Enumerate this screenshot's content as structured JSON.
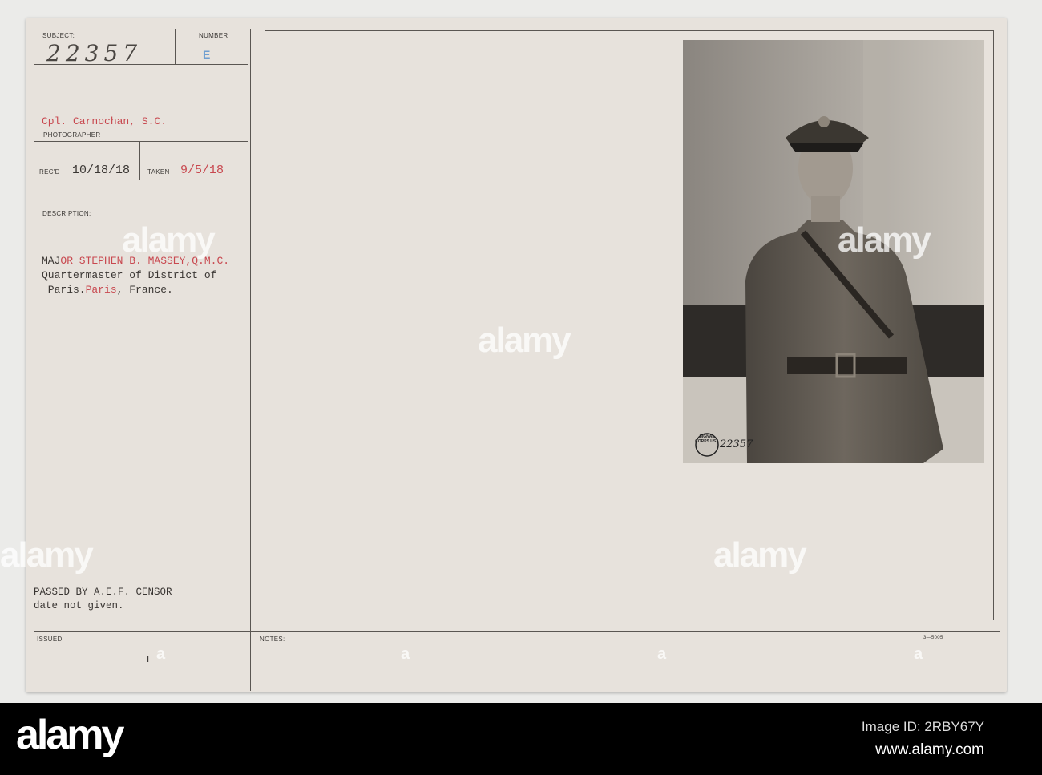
{
  "card": {
    "subject_label": "SUBJECT:",
    "subject_value": "22357",
    "number_label": "NUMBER",
    "number_value": "E",
    "photographer_value": "Cpl. Carnochan, S.C.",
    "photographer_label": "PHOTOGRAPHER",
    "recd_label": "REC'D",
    "recd_value": "10/18/18",
    "taken_label": "TAKEN",
    "taken_value": "9/5/18",
    "description_label": "DESCRIPTION:",
    "description_line1_a": "MAJ",
    "description_line1_b": "OR STEPHEN B. MASSEY,Q.M.C.",
    "description_line2": "Quartermaster of District of",
    "description_line3_a": " Paris.",
    "description_line3_b": "Paris",
    "description_line3_c": ", France.",
    "censor_line1": "PASSED BY A.E.F. CENSOR",
    "censor_line2": "date not given.",
    "issued_label": "ISSUED",
    "issued_value": "T",
    "notes_label": "NOTES:",
    "form_number": "3—5005",
    "photo_stamp_number": "22357",
    "photo_stamp_text": "SIGNAL CORPS USA"
  },
  "watermark": {
    "text": "alamy",
    "small": "a"
  },
  "footer": {
    "logo": "alamy",
    "image_id": "Image ID: 2RBY67Y",
    "url": "www.alamy.com"
  },
  "colors": {
    "red_ink": "#c8484f",
    "blue_stamp": "#6f9ed0",
    "footer_bg": "#000000"
  }
}
